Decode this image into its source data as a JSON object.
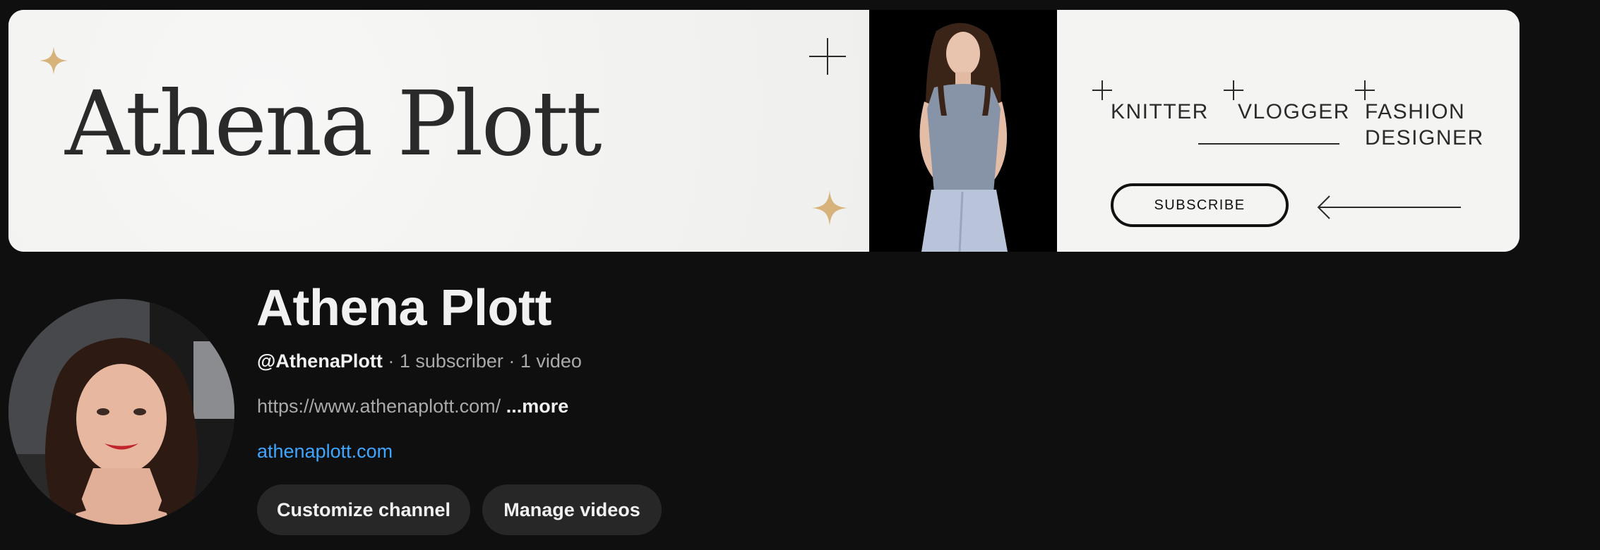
{
  "banner": {
    "name": "Athena Plott",
    "roles": [
      "KNITTER",
      "VLOGGER",
      "FASHION",
      "DESIGNER"
    ],
    "subscribe_label": "SUBSCRIBE",
    "colors": {
      "background": "#f4f4f3",
      "sparkle": "#d7b27a",
      "text": "#2a2a2a"
    }
  },
  "channel": {
    "title": "Athena Plott",
    "handle": "@AthenaPlott",
    "stats": " · 1 subscriber · 1 video",
    "description": "https://www.athenaplott.com/",
    "more_label": "...more",
    "link": "athenaplott.com",
    "link_color": "#3ea6ff"
  },
  "actions": {
    "customize_label": "Customize channel",
    "manage_label": "Manage videos"
  }
}
